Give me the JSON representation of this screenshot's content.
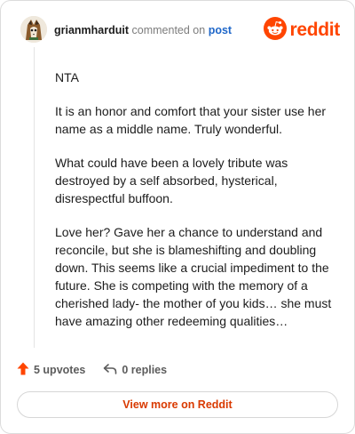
{
  "header": {
    "username": "grianmharduit",
    "action_text": "commented on",
    "post_link": "post",
    "brand_name": "reddit",
    "avatar_icon": "fox-avatar-icon"
  },
  "comment": {
    "paragraphs": [
      "NTA",
      "It is an honor and comfort that your sister use her name as a middle name. Truly wonderful.",
      "What could have been a lovely tribute was destroyed by a self absorbed, hysterical, disrespectful buffoon.",
      "Love her? Gave her a chance to understand and reconcile, but she is blameshifting and doubling down. This seems like a crucial impediment to the future. She is competing with the memory of a cherished lady- the mother of you kids… she must have amazing other redeeming qualities…"
    ]
  },
  "actions": {
    "upvotes_label": "5 upvotes",
    "replies_label": "0 replies"
  },
  "footer": {
    "view_more_label": "View more on Reddit"
  },
  "colors": {
    "brand": "#ff4500",
    "link": "#1f67c9",
    "view_more_text": "#d93a00",
    "upvote_arrow": "#ff4500"
  }
}
